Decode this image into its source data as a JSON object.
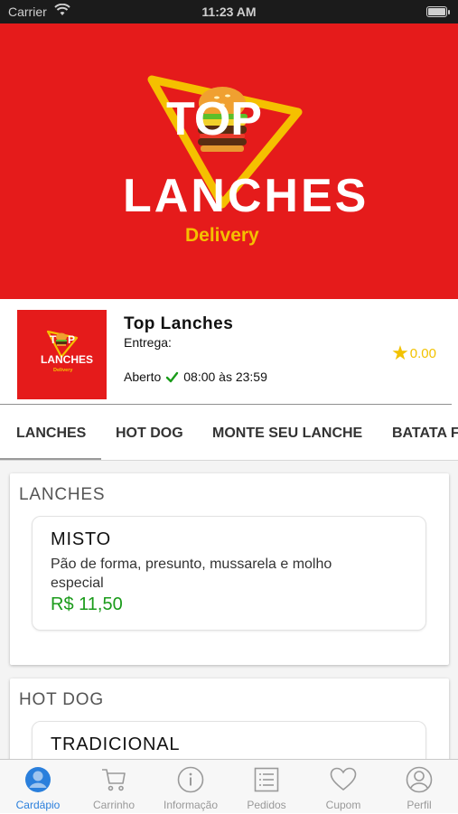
{
  "status_bar": {
    "carrier": "Carrier",
    "time": "11:23 AM"
  },
  "banner": {
    "logo_top": "TOP",
    "logo_main": "LANCHES",
    "logo_sub": "Delivery"
  },
  "store": {
    "name": "Top Lanches",
    "entrega_label": "Entrega:",
    "status": "Aberto",
    "hours": "08:00 às 23:59",
    "rating": "0.00"
  },
  "categories": [
    "LANCHES",
    "HOT DOG",
    "MONTE SEU LANCHE",
    "BATATA F"
  ],
  "menu": {
    "sections": [
      {
        "title": "LANCHES",
        "products": [
          {
            "name": "MISTO",
            "description": "Pão de forma, presunto, mussarela e molho especial",
            "price": "R$ 11,50"
          }
        ]
      },
      {
        "title": "HOT DOG",
        "products": [
          {
            "name": "TRADICIONAL"
          }
        ]
      }
    ]
  },
  "tab_bar": {
    "items": [
      {
        "label": "Cardápio",
        "icon": "user-circle-icon",
        "active": true
      },
      {
        "label": "Carrinho",
        "icon": "cart-icon",
        "active": false
      },
      {
        "label": "Informação",
        "icon": "info-icon",
        "active": false
      },
      {
        "label": "Pedidos",
        "icon": "list-icon",
        "active": false
      },
      {
        "label": "Cupom",
        "icon": "heart-icon",
        "active": false
      },
      {
        "label": "Perfil",
        "icon": "person-icon",
        "active": false
      }
    ]
  },
  "colors": {
    "brand_red": "#e51b1b",
    "logo_yellow": "#f5c000",
    "price_green": "#1a9b1a",
    "active_blue": "#2a7fdc",
    "star_yellow": "#f2c200"
  }
}
